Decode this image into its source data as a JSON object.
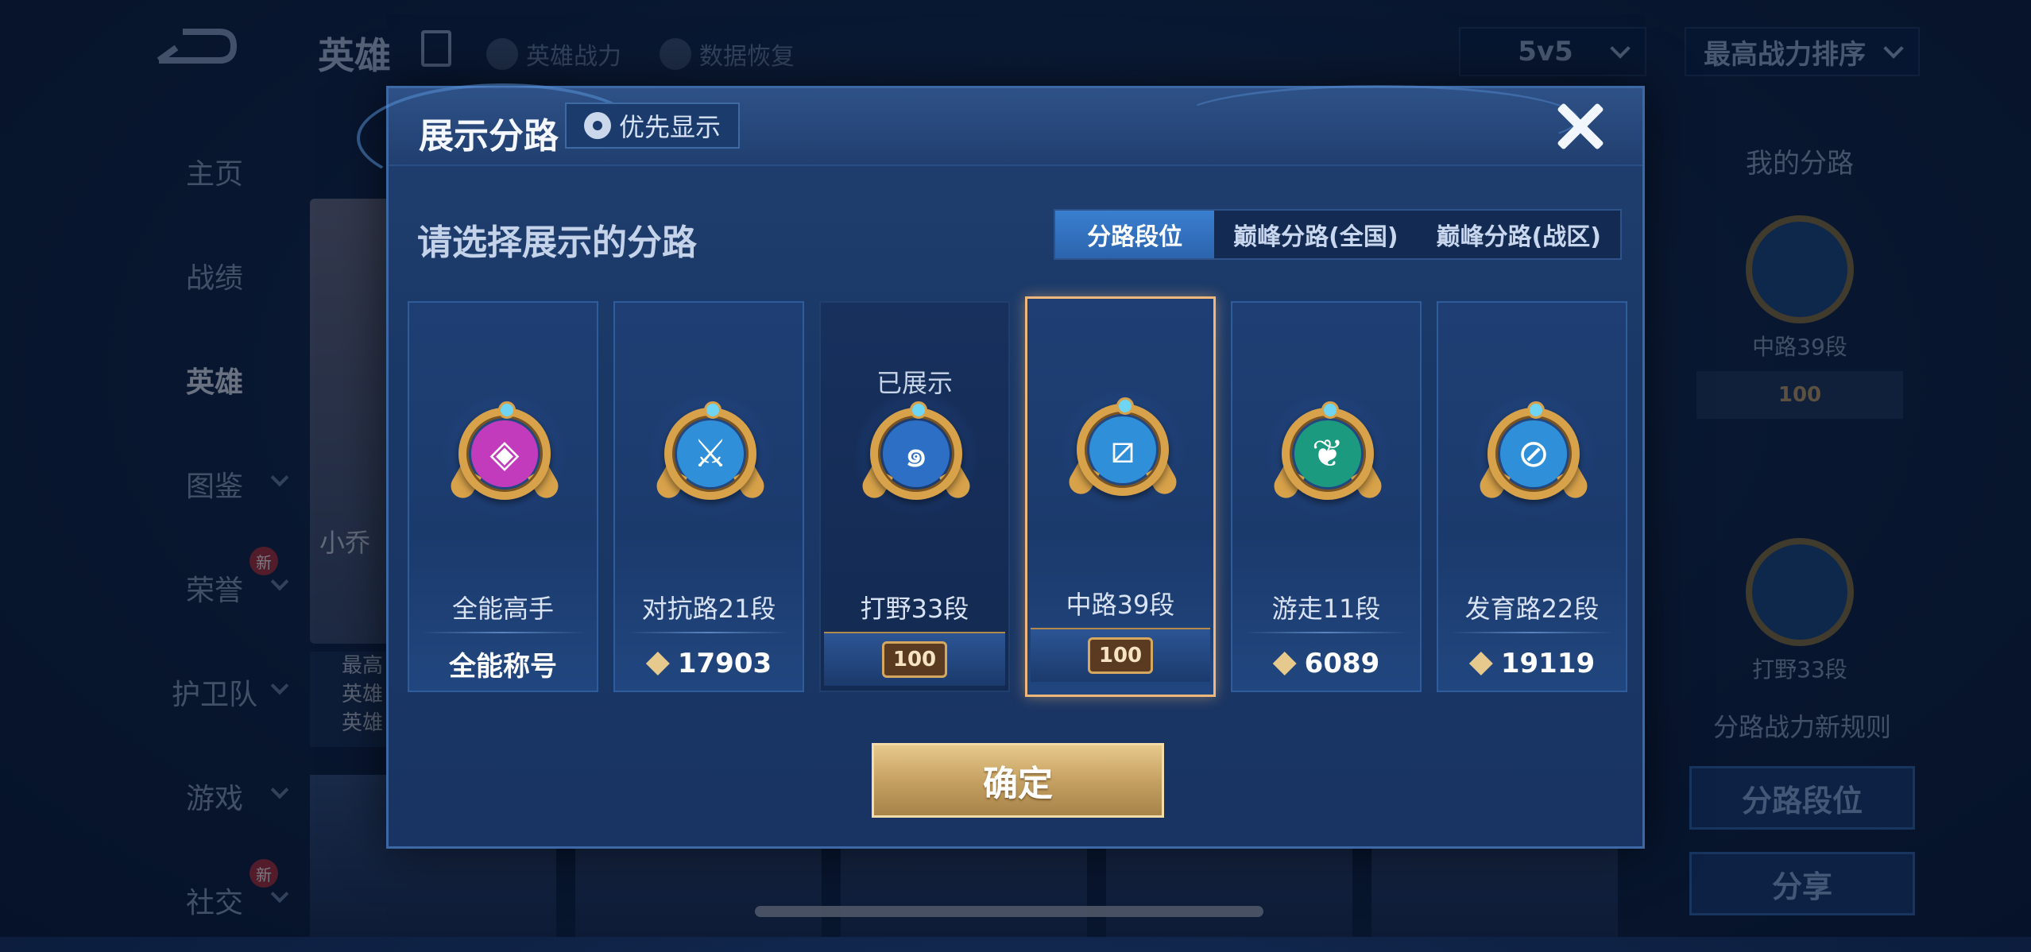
{
  "background": {
    "top_title": "英雄",
    "hero_power_link": "英雄战力",
    "data_restore_link": "数据恢复",
    "mode_select": "5v5",
    "sort_select": "最高战力排序",
    "sidebar": [
      {
        "label": "主页",
        "chevron": false,
        "new": false
      },
      {
        "label": "战绩",
        "chevron": false,
        "new": false
      },
      {
        "label": "英雄",
        "chevron": false,
        "new": false,
        "active": true
      },
      {
        "label": "图鉴",
        "chevron": true,
        "new": false
      },
      {
        "label": "荣誉",
        "chevron": true,
        "new": true
      },
      {
        "label": "护卫队",
        "chevron": true,
        "new": false
      },
      {
        "label": "游戏",
        "chevron": true,
        "new": false
      },
      {
        "label": "社交",
        "chevron": true,
        "new": true
      }
    ],
    "new_badge": "新",
    "hero_name": "小乔",
    "hero_info": [
      "最高",
      "英雄",
      "英雄"
    ],
    "right_panel": {
      "title": "我的分路",
      "lane1_label": "中路39段",
      "lane1_rank": "100",
      "lane2_label": "打野33段",
      "note": "分路战力新规则",
      "lane_rank_button": "分路段位",
      "share_button": "分享"
    }
  },
  "modal": {
    "title": "展示分路",
    "priority_button": "优先显示",
    "subtitle": "请选择展示的分路",
    "tabs": [
      {
        "label": "分路段位",
        "selected": true
      },
      {
        "label": "巅峰分路(全国)",
        "selected": false
      },
      {
        "label": "巅峰分路(战区)",
        "selected": false
      }
    ],
    "cards": [
      {
        "lane": "全能高手",
        "stat": "全能称号",
        "stat_type": "title",
        "emblem_color": "#c23bbd",
        "emblem_glyph": "◈",
        "shown": false,
        "active": false
      },
      {
        "lane": "对抗路21段",
        "stat": "17903",
        "stat_type": "power",
        "emblem_color": "#2f8fd8",
        "emblem_glyph": "⚔",
        "shown": false,
        "active": false
      },
      {
        "lane": "打野33段",
        "stat": "100",
        "stat_type": "rank",
        "emblem_color": "#2c6fc4",
        "emblem_glyph": "๑",
        "shown": true,
        "shown_label": "已展示",
        "active": false
      },
      {
        "lane": "中路39段",
        "stat": "100",
        "stat_type": "rank",
        "emblem_color": "#2f8fd8",
        "emblem_glyph": "⧄",
        "shown": false,
        "active": true
      },
      {
        "lane": "游走11段",
        "stat": "6089",
        "stat_type": "power",
        "emblem_color": "#1c9a80",
        "emblem_glyph": "❦",
        "shown": false,
        "active": false
      },
      {
        "lane": "发育路22段",
        "stat": "19119",
        "stat_type": "power",
        "emblem_color": "#2f8fd8",
        "emblem_glyph": "⊘",
        "shown": false,
        "active": false
      }
    ],
    "confirm_button": "确定"
  }
}
